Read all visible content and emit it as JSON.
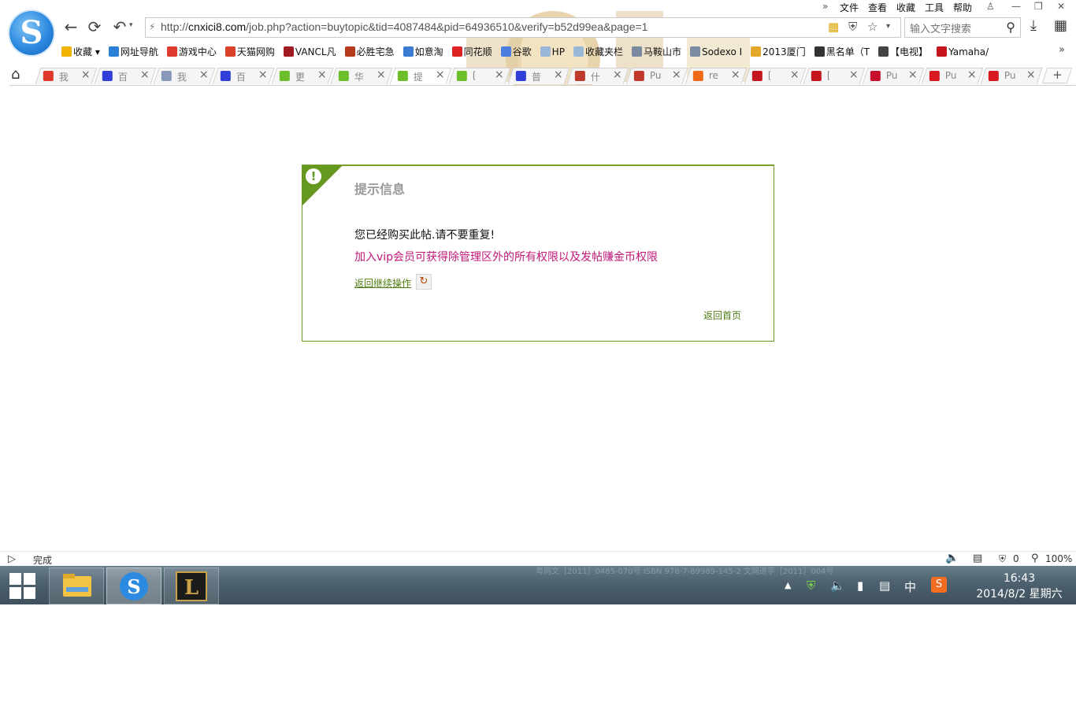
{
  "browser": {
    "menu": [
      "文件",
      "查看",
      "收藏",
      "工具",
      "帮助"
    ],
    "address_url": "http://cnxici8.com/job.php?action=buytopic&tid=4087484&pid=64936510&verify=b52d99ea&page=1",
    "address_url_prefix": "http://",
    "address_url_host": "cnxici8.com",
    "address_url_path": "/job.php?action=buytopic&tid=4087484&pid=64936510&verify=b52d99ea&page=1",
    "search_placeholder": "输入文字搜索",
    "bookmarks": [
      {
        "label": "收藏",
        "icon": "star-icon",
        "color": "#f0b400"
      },
      {
        "label": "网址导航",
        "icon": "sogou-icon",
        "color": "#2a7fd6"
      },
      {
        "label": "游戏中心",
        "icon": "game-icon",
        "color": "#e03a2f"
      },
      {
        "label": "天猫网购",
        "icon": "tmall-icon",
        "color": "#d9412b"
      },
      {
        "label": "VANCL凡",
        "icon": "vancl-icon",
        "color": "#a01c22"
      },
      {
        "label": "必胜宅急",
        "icon": "pizzahut-icon",
        "color": "#b33a1a"
      },
      {
        "label": "如意淘",
        "icon": "ruyitao-icon",
        "color": "#3a7bd5"
      },
      {
        "label": "同花顺",
        "icon": "tonghuashun-icon",
        "color": "#d22"
      },
      {
        "label": "谷歌",
        "icon": "google-icon",
        "color": "#4a7fe0"
      },
      {
        "label": "HP",
        "icon": "folder-icon",
        "color": "#9bb7d8"
      },
      {
        "label": "收藏夹栏",
        "icon": "folder-icon",
        "color": "#9bb7d8"
      },
      {
        "label": "马鞍山市",
        "icon": "page-icon",
        "color": "#7a8aa0"
      },
      {
        "label": "Sodexo I",
        "icon": "page-icon",
        "color": "#7a8aa0"
      },
      {
        "label": "2013厦门",
        "icon": "m-icon",
        "color": "#e3a829"
      },
      {
        "label": "黑名单（T",
        "icon": "panda-icon",
        "color": "#333333"
      },
      {
        "label": "【电视】",
        "icon": "clapper-icon",
        "color": "#444444"
      },
      {
        "label": "Yamaha/",
        "icon": "tmall-t-icon",
        "color": "#c4161c"
      }
    ],
    "tabs": [
      {
        "title": "我",
        "icon": "weibo-icon",
        "color": "#e0372c"
      },
      {
        "title": "百",
        "icon": "baidu-icon",
        "color": "#2f3fd8"
      },
      {
        "title": "我",
        "icon": "grid-icon",
        "color": "#8899bb"
      },
      {
        "title": "百",
        "icon": "baidu-icon",
        "color": "#2f3fd8"
      },
      {
        "title": "更",
        "icon": "leaf-icon",
        "color": "#6cbf2a"
      },
      {
        "title": "华",
        "icon": "leaf-icon",
        "color": "#6cbf2a"
      },
      {
        "title": "提",
        "icon": "leaf-icon",
        "color": "#6cbf2a"
      },
      {
        "title": "[",
        "icon": "leaf-icon",
        "color": "#6cbf2a"
      },
      {
        "title": "普",
        "icon": "baidu-icon",
        "color": "#2f3fd8"
      },
      {
        "title": "什",
        "icon": "seal-icon",
        "color": "#c0392b"
      },
      {
        "title": "Pu",
        "icon": "seal-icon",
        "color": "#c0392b"
      },
      {
        "title": "re",
        "icon": "taobao-icon",
        "color": "#f06a1a"
      },
      {
        "title": "[",
        "icon": "tmall-t-icon",
        "color": "#c4161c"
      },
      {
        "title": "[",
        "icon": "tmall-t-icon",
        "color": "#c4161c"
      },
      {
        "title": "Pu",
        "icon": "jd-icon",
        "color": "#c8102e"
      },
      {
        "title": "Pu",
        "icon": "yhd-icon",
        "color": "#d71920"
      },
      {
        "title": "Pu",
        "icon": "yhd-icon",
        "color": "#d71920"
      }
    ],
    "active_tab_index": 6
  },
  "message": {
    "title": "提示信息",
    "text": "您已经购买此帖.请不要重复!",
    "vip_text": "加入vip会员可获得除管理区外的所有权限以及发帖赚金币权限",
    "back_link": "返回继续操作",
    "home_link": "返回首页"
  },
  "statusbar": {
    "status": "完成",
    "adblock_count": "0",
    "zoom": "100%"
  },
  "taskbar": {
    "faint_text": "粤网文［2011］0485-070号  ISBN 978-7-89989-145-2    文网进字［2011］004号",
    "ime_label": "中",
    "time": "16:43",
    "date": "2014/8/2 星期六"
  }
}
